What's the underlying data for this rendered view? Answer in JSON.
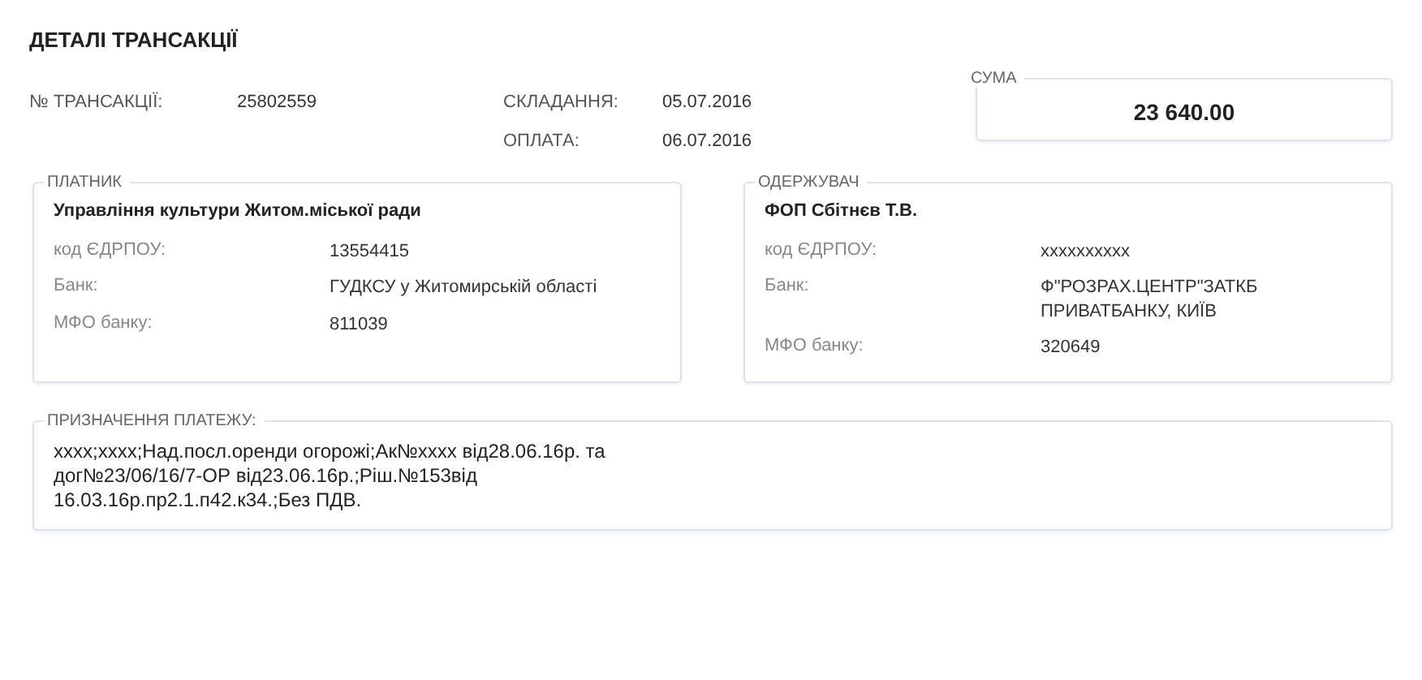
{
  "title": "ДЕТАЛІ ТРАНСАКЦІЇ",
  "info": [
    {
      "label": "№ ТРАНСАКЦІЇ:",
      "value": "25802559"
    },
    {
      "label": "СКЛАДАННЯ:",
      "value": "05.07.2016"
    },
    {
      "label": "ОПЛАТА:",
      "value": "06.07.2016"
    }
  ],
  "sum": {
    "legend": "СУМА",
    "value": "23 640.00"
  },
  "parties": [
    {
      "legend": "ПЛАТНИК",
      "name": "Управління культури Житом.міської ради",
      "fields": [
        {
          "label": "код ЄДРПОУ:",
          "value": "13554415"
        },
        {
          "label": "Банк:",
          "value": "ГУДКСУ у Житомирській області"
        },
        {
          "label": "МФО банку:",
          "value": "811039"
        }
      ]
    },
    {
      "legend": "ОДЕРЖУВАЧ",
      "name": "ФОП Сбітнєв Т.В.",
      "fields": [
        {
          "label": "код ЄДРПОУ:",
          "value": "xxxxxxxxxx"
        },
        {
          "label": "Банк:",
          "value": "Ф\"РОЗРАХ.ЦЕНТР\"ЗАТКБ ПРИВАТБАНКУ, КИЇВ"
        },
        {
          "label": "МФО банку:",
          "value": "320649"
        }
      ]
    }
  ],
  "purpose": {
    "legend": "ПРИЗНАЧЕННЯ ПЛАТЕЖУ:",
    "text": "xxxx;xxxx;Над.посл.оренди огорожі;Ак№xxxx від28.06.16р. та дог№23/06/16/7-ОР від23.06.16р.;Ріш.№153від 16.03.16р.пр2.1.п42.к34.;Без ПДВ."
  }
}
